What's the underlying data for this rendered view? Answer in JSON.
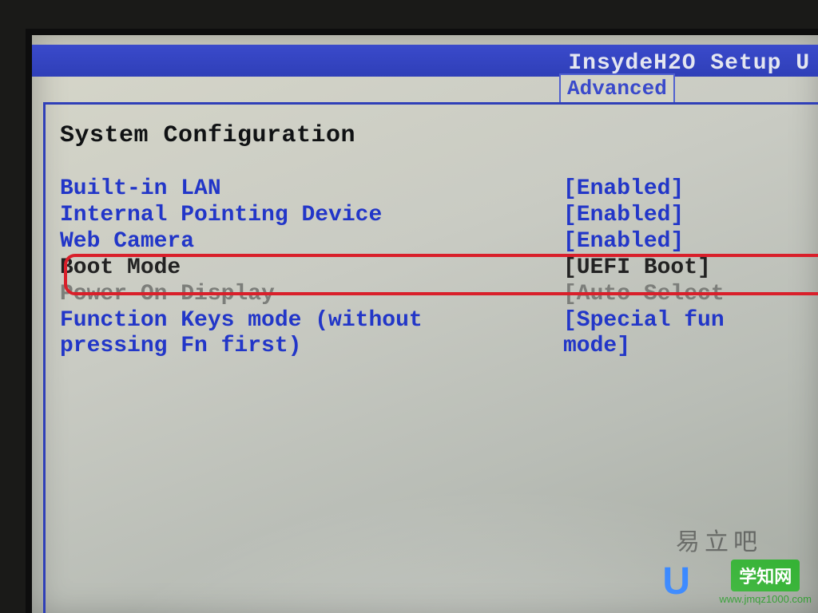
{
  "header": {
    "title": "InsydeH2O Setup U",
    "active_tab": "Advanced"
  },
  "section_title": "System Configuration",
  "items": [
    {
      "label": "Built-in LAN",
      "value": "[Enabled]",
      "state": "active"
    },
    {
      "label": "Internal Pointing Device",
      "value": "[Enabled]",
      "state": "active"
    },
    {
      "label": "Web Camera",
      "value": "[Enabled]",
      "state": "active"
    },
    {
      "label": "Boot Mode",
      "value": "[UEFI Boot]",
      "state": "dark",
      "highlight": true
    },
    {
      "label": "Power On Display",
      "value": "[Auto-Select",
      "state": "dim"
    },
    {
      "label": "Function Keys mode (without pressing Fn first)",
      "value": "[Special fun mode]",
      "state": "active",
      "wrap": true
    }
  ],
  "watermarks": {
    "faint": "易立吧",
    "badge": "学知网",
    "url": "www.jmqz1000.com",
    "logo": "U"
  }
}
